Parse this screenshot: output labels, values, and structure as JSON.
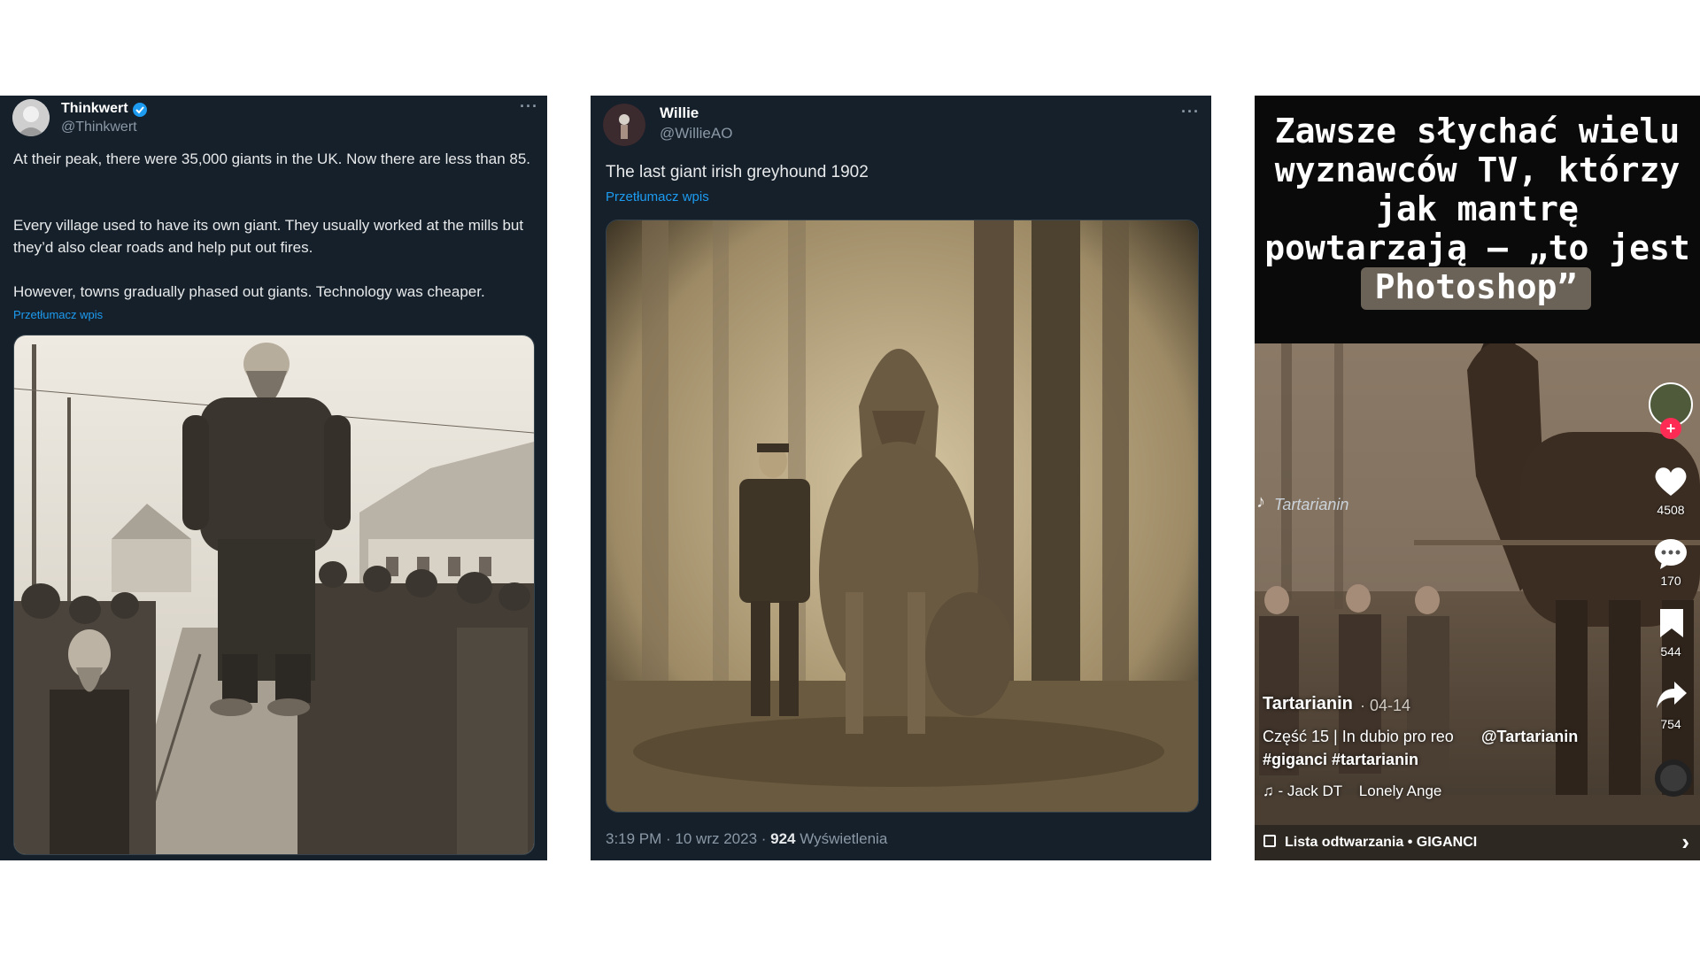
{
  "tweet1": {
    "name": "Thinkwert",
    "handle": "@Thinkwert",
    "more": "···",
    "paragraphs": [
      "At their peak, there were 35,000 giants in the UK. Now there are less than 85.",
      "Every village used to have its own giant. They usually worked at the mills but they’d also clear roads and help put out fires.",
      "However, towns gradually phased out giants. Technology was cheaper."
    ],
    "translate": "Przetłumacz wpis"
  },
  "tweet2": {
    "name": "Willie",
    "handle": "@WillieAO",
    "more": "···",
    "text": "The last giant irish greyhound 1902",
    "translate": "Przetłumacz wpis",
    "meta_time": "3:19 PM · 10 wrz 2023 · ",
    "views_count": "924",
    "views_label": " Wyświetlenia"
  },
  "tiktok": {
    "caption_lines": [
      "Zawsze słychać wielu",
      "wyznawców TV, którzy",
      "jak mantrę",
      "powtarzają – „to jest",
      "Photoshop”"
    ],
    "watermark": "Tartarianin",
    "likes": "4508",
    "comments": "170",
    "saves": "544",
    "shares": "754",
    "author": "Tartarianin",
    "date": "· 04-14",
    "desc_line": "Część 15 | In dubio pro reo",
    "mention": "@Tartarianin",
    "hashtags": "#giganci #tartarianin",
    "music": "♫ - Jack DT    Lonely Ange",
    "playlist": "Lista odtwarzania • GIGANCI",
    "chevron": "›",
    "colors": {
      "plus": "#fe2c55",
      "accent": "#1d9bf0"
    }
  }
}
